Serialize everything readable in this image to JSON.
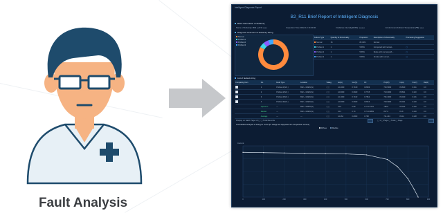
{
  "caption": "Fault Analysis",
  "report": {
    "window_title": "Intelligent Diagnosis Report",
    "title": "B2_R11 Brief Report of Intelligent Diagnosis",
    "basic_info_header": "Basic Information of Subarray",
    "basic_info": [
      "Name of Subarray: B02 ▢ R11 ▢▢",
      "Inspection Time:2022-0-0 14:00:00",
      "Irradiance Intensity(W/M²): ▢▢▢",
      "Environment Ambient Temperature(℃): ▢▢"
    ],
    "diag_header": "Diagnosis Overview of Subarray String",
    "pie_legend": [
      "Normal",
      "Problem1",
      "Problem2",
      "Problem3"
    ],
    "overview_headers": [
      "Failure Type",
      "Quantity of Abnormality",
      "Proportion",
      "Description of Abnormality",
      "Processing Suggestion"
    ],
    "overview_rows": [
      {
        "type": "Normal",
        "qty": "15",
        "pct": "83.33%",
        "desc": "Normal",
        "sugg": ""
      },
      {
        "type": "Problem1",
        "qty": "1",
        "pct": "5.56%",
        "desc": "Compared with normal...",
        "sugg": "▢"
      },
      {
        "type": "Problem2",
        "qty": "1",
        "pct": "5.56%",
        "desc": "Diode with normal path...",
        "sugg": "▢"
      },
      {
        "type": "Problem3",
        "qty": "1",
        "pct": "5.56%",
        "desc": "Similar with normal...",
        "sugg": "▢"
      }
    ],
    "faulted_header": "List of faulted string",
    "faulted_columns": [
      "Comparing Item",
      "No.",
      "Fault Type",
      "Location",
      "Voltag",
      "Isc(A)",
      "Voc(V)",
      "FF",
      "Pm(W)",
      "Im(A)",
      "Vm(V)",
      "Rs(Ω)"
    ],
    "faulted_rows": [
      [
        "",
        "1",
        "Problem1(NO.)",
        "B02 + MARG(S)",
        "▢▢",
        "14.2000",
        "0.7160",
        "0.8003",
        "716.5000",
        "8.4820",
        "3.161",
        "0.0"
      ],
      [
        "",
        "2",
        "Problem2(NO.)",
        "B02 + MARG(S)",
        "▢▢",
        "14.6000",
        "0.6923",
        "0.7715",
        "713.0000",
        "8.6821",
        "3.110",
        "0.0"
      ],
      [
        "",
        "3",
        "Problem3(NO.)",
        "B02 + MARG(S)",
        "▢▢",
        "14.1000",
        "0.7162",
        "0.7812",
        "701.3000",
        "8.4020",
        "3.101",
        "0.0"
      ],
      [
        "",
        "4",
        "Problem4(NO.)",
        "B02 + MARG(S)",
        "▢▢",
        "14.0000",
        "0.6923",
        "0.8013",
        "704.9000",
        "8.4021",
        "3.120",
        "0.0"
      ],
      [
        "",
        "Optimum",
        "—",
        "B02 + MARG(S)",
        "▢▢",
        "14.9",
        "0.89",
        "0.71 2.2176",
        "789.8",
        "8.4022",
        "3.150",
        "0.0"
      ],
      [
        "",
        "Median",
        "—",
        "B02 + MARG(S)",
        "▢▢",
        "13.3",
        "0.74",
        "0.71 0.8883",
        "817.0",
        "8.18",
        "3.120",
        "0.0"
      ],
      [
        "",
        "Average",
        "—",
        "—",
        "▢▢",
        "14.462",
        "0.8063",
        "0.768",
        "711.234",
        "8.412",
        "3.128",
        "0.0"
      ]
    ],
    "pagination_text": "Display on Each Page 10 ▢ ▢ Total Records",
    "pager_text": "▢ 1 ▢ Page ▢ Total ▢ Page",
    "curve_caption": "Contrastive analysis of string IV curve (IV design as supposed for comparison curves)",
    "curve_legend": [
      "Diffuse",
      "Module"
    ],
    "y_label": "Current"
  },
  "chart_data": {
    "type": "line",
    "series": [
      {
        "name": "Diffuse",
        "x": [
          0,
          100,
          200,
          300,
          400,
          500,
          600,
          700,
          750,
          800,
          830,
          850
        ],
        "y": [
          14.0,
          13.9,
          13.8,
          13.7,
          13.6,
          13.5,
          13.2,
          11.8,
          9.5,
          5.8,
          2.5,
          0
        ]
      }
    ],
    "xlim": [
      0,
      900
    ],
    "ylim": [
      0,
      16
    ],
    "xticks": [
      "0",
      "100",
      "200",
      "300",
      "400",
      "500",
      "600",
      "700",
      "800",
      "900"
    ],
    "grid": true
  },
  "colors": {
    "pie": [
      "#ff8a3d",
      "#3dd6e6",
      "#8a5cff",
      "#3ea7ff"
    ],
    "doctor_skin": "#f6b383",
    "doctor_hair": "#1e4b6c",
    "doctor_coat": "#e7f0f6",
    "doctor_cross": "#1e4b6c",
    "arrow": "#c6c8cb"
  }
}
